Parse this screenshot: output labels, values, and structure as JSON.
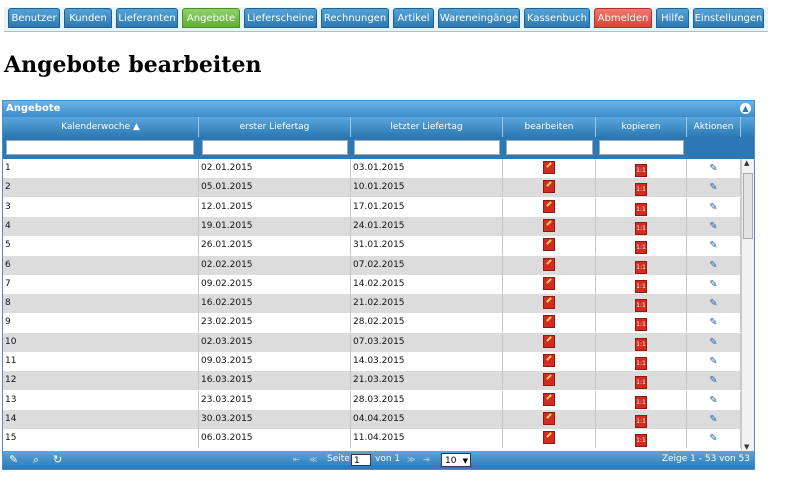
{
  "nav": {
    "tabs": [
      "Benutzer",
      "Kunden",
      "Lieferanten",
      "Angebote",
      "Lieferscheine",
      "Rechnungen",
      "Artikel",
      "Wareneingänge",
      "Kassenbuch",
      "Abmelden",
      "Hilfe",
      "Einstellungen"
    ],
    "active": "Angebote"
  },
  "page": {
    "title": "Angebote bearbeiten"
  },
  "grid": {
    "caption": "Angebote",
    "columns": [
      "Kalenderwoche",
      "erster Liefertag",
      "letzter Liefertag",
      "bearbeiten",
      "kopieren",
      "Aktionen"
    ],
    "sort_icon": "sort-up-icon",
    "rows": [
      {
        "kw": "1",
        "first": "02.01.2015",
        "last": "03.01.2015"
      },
      {
        "kw": "2",
        "first": "05.01.2015",
        "last": "10.01.2015"
      },
      {
        "kw": "3",
        "first": "12.01.2015",
        "last": "17.01.2015"
      },
      {
        "kw": "4",
        "first": "19.01.2015",
        "last": "24.01.2015"
      },
      {
        "kw": "5",
        "first": "26.01.2015",
        "last": "31.01.2015"
      },
      {
        "kw": "6",
        "first": "02.02.2015",
        "last": "07.02.2015"
      },
      {
        "kw": "7",
        "first": "09.02.2015",
        "last": "14.02.2015"
      },
      {
        "kw": "8",
        "first": "16.02.2015",
        "last": "21.02.2015"
      },
      {
        "kw": "9",
        "first": "23.02.2015",
        "last": "28.02.2015"
      },
      {
        "kw": "10",
        "first": "02.03.2015",
        "last": "07.03.2015"
      },
      {
        "kw": "11",
        "first": "09.03.2015",
        "last": "14.03.2015"
      },
      {
        "kw": "12",
        "first": "16.03.2015",
        "last": "21.03.2015"
      },
      {
        "kw": "13",
        "first": "23.03.2015",
        "last": "28.03.2015"
      },
      {
        "kw": "14",
        "first": "30.03.2015",
        "last": "04.04.2015"
      },
      {
        "kw": "15",
        "first": "06.03.2015",
        "last": "11.04.2015"
      }
    ],
    "copy_icon_label": "1:1"
  },
  "pager": {
    "page_label": "Seite",
    "page_value": "1",
    "of_label": "von 1",
    "page_size": "10",
    "summary": "Zeige 1 - 53 von 53"
  },
  "colors": {
    "tab": "#2c78b3",
    "active_tab": "#5fae35",
    "logout_tab": "#d9423a",
    "header": "#3b8ccb",
    "row_alt": "#dcdcdc"
  }
}
